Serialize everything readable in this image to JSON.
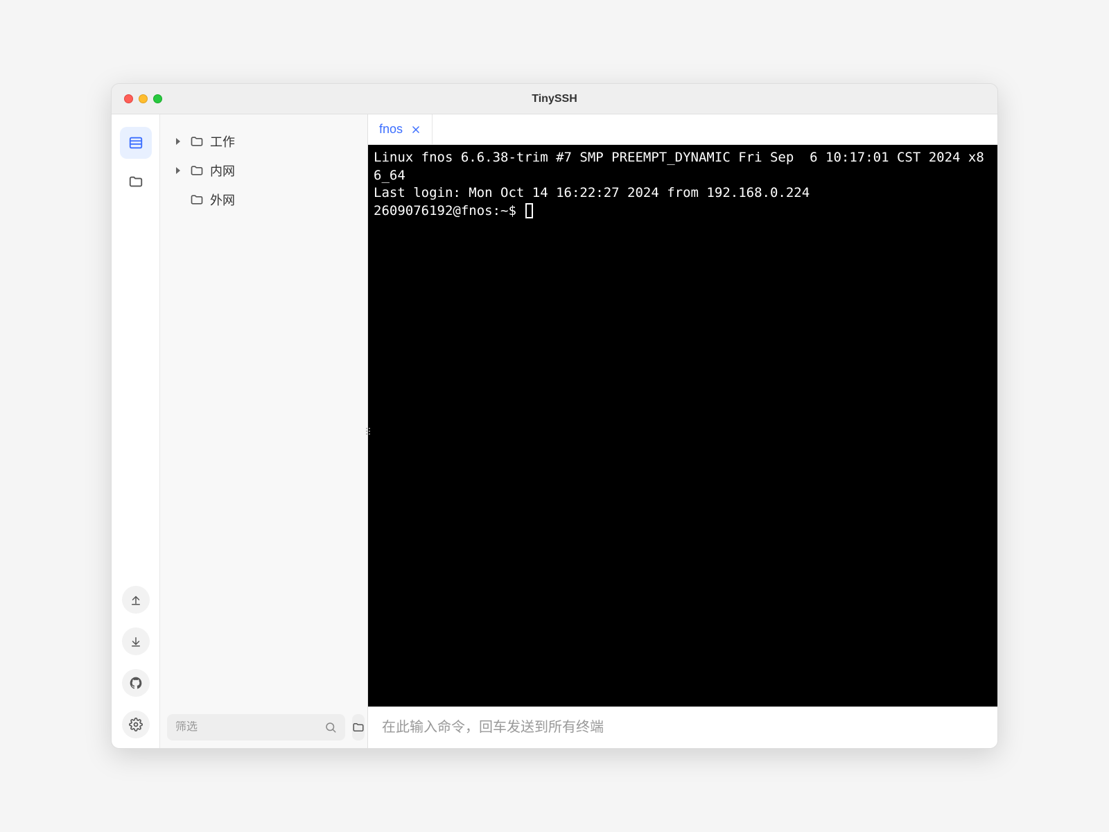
{
  "window": {
    "title": "TinySSH"
  },
  "rail": {
    "items": [
      {
        "name": "hosts",
        "icon": "list-icon",
        "active": true
      },
      {
        "name": "files",
        "icon": "folder-icon",
        "active": false
      }
    ],
    "bottom": [
      {
        "name": "upload",
        "icon": "upload-icon"
      },
      {
        "name": "download",
        "icon": "download-icon"
      },
      {
        "name": "github",
        "icon": "github-icon"
      },
      {
        "name": "settings",
        "icon": "gear-icon"
      }
    ]
  },
  "sidebar": {
    "tree": [
      {
        "label": "工作",
        "expandable": true
      },
      {
        "label": "内网",
        "expandable": true
      },
      {
        "label": "外网",
        "expandable": false
      }
    ],
    "filter_placeholder": "筛选",
    "footer_buttons": [
      {
        "name": "open-folder",
        "icon": "folder-icon"
      },
      {
        "name": "open-terminal",
        "icon": "terminal-icon"
      }
    ]
  },
  "tabs": [
    {
      "label": "fnos",
      "active": true
    }
  ],
  "terminal": {
    "line1": "Linux fnos 6.6.38-trim #7 SMP PREEMPT_DYNAMIC Fri Sep  6 10:17:01 CST 2024 x86_64",
    "line2": "Last login: Mon Oct 14 16:22:27 2024 from 192.168.0.224",
    "prompt": "2609076192@fnos:~$ "
  },
  "cmd_placeholder": "在此输入命令，回车发送到所有终端"
}
